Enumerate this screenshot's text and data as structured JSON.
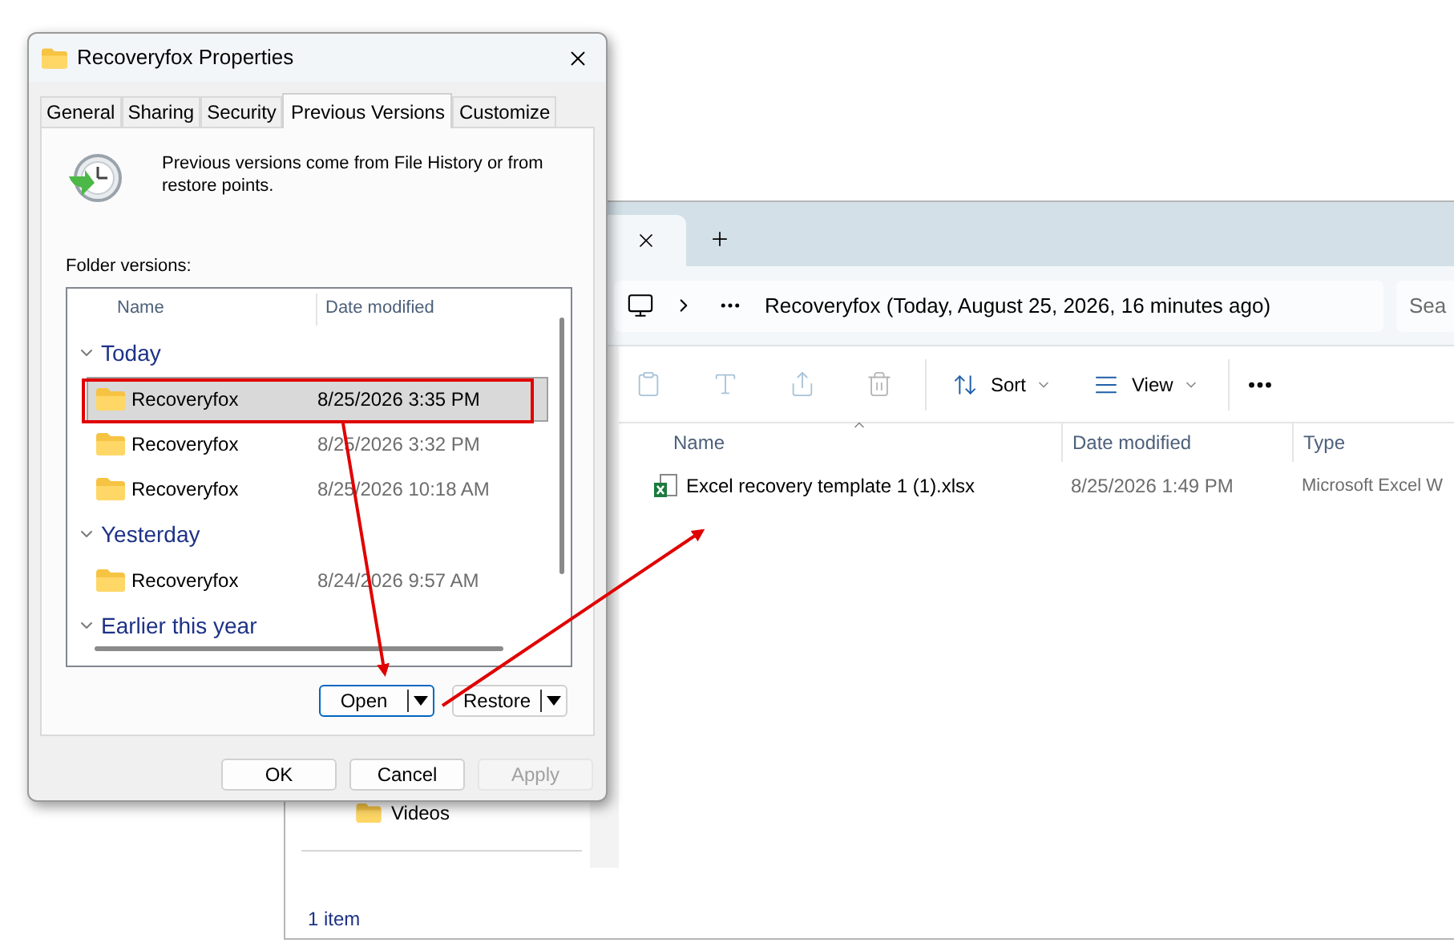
{
  "dialog": {
    "title": "Recoveryfox Properties",
    "tabs": [
      {
        "label": "General",
        "selected": false
      },
      {
        "label": "Sharing",
        "selected": false
      },
      {
        "label": "Security",
        "selected": false
      },
      {
        "label": "Previous Versions",
        "selected": true
      },
      {
        "label": "Customize",
        "selected": false
      }
    ],
    "description": "Previous versions come from File History or from restore points.",
    "list_label": "Folder versions:",
    "columns": [
      "Name",
      "Date modified"
    ],
    "groups": [
      {
        "label": "Today",
        "expanded": true,
        "items": [
          {
            "name": "Recoveryfox",
            "date": "8/25/2026 3:35 PM",
            "selected": true
          },
          {
            "name": "Recoveryfox",
            "date": "8/25/2026 3:32 PM",
            "selected": false
          },
          {
            "name": "Recoveryfox",
            "date": "8/25/2026 10:18 AM",
            "selected": false
          }
        ]
      },
      {
        "label": "Yesterday",
        "expanded": true,
        "items": [
          {
            "name": "Recoveryfox",
            "date": "8/24/2026 9:57 AM",
            "selected": false
          }
        ]
      },
      {
        "label": "Earlier this year",
        "expanded": true
      }
    ],
    "action_buttons": [
      {
        "label": "Open",
        "focused": true
      },
      {
        "label": "Restore",
        "focused": false
      }
    ],
    "footer_buttons": [
      {
        "label": "OK",
        "disabled": false
      },
      {
        "label": "Cancel",
        "disabled": false
      },
      {
        "label": "Apply",
        "disabled": true
      }
    ]
  },
  "explorer": {
    "address": "Recoveryfox (Today, August 25, 2026, 16 minutes ago)",
    "search_placeholder": "Sea",
    "toolbar": [
      {
        "label": "Sort",
        "kind": "sort"
      },
      {
        "label": "View",
        "kind": "view"
      }
    ],
    "columns": [
      "Name",
      "Date modified",
      "Type"
    ],
    "files": [
      {
        "name": "Excel recovery template 1 (1).xlsx",
        "date": "8/25/2026 1:49 PM",
        "type": "Microsoft Excel W"
      }
    ],
    "sidebar": [
      {
        "label": "Videos"
      }
    ],
    "status": "1 item"
  }
}
